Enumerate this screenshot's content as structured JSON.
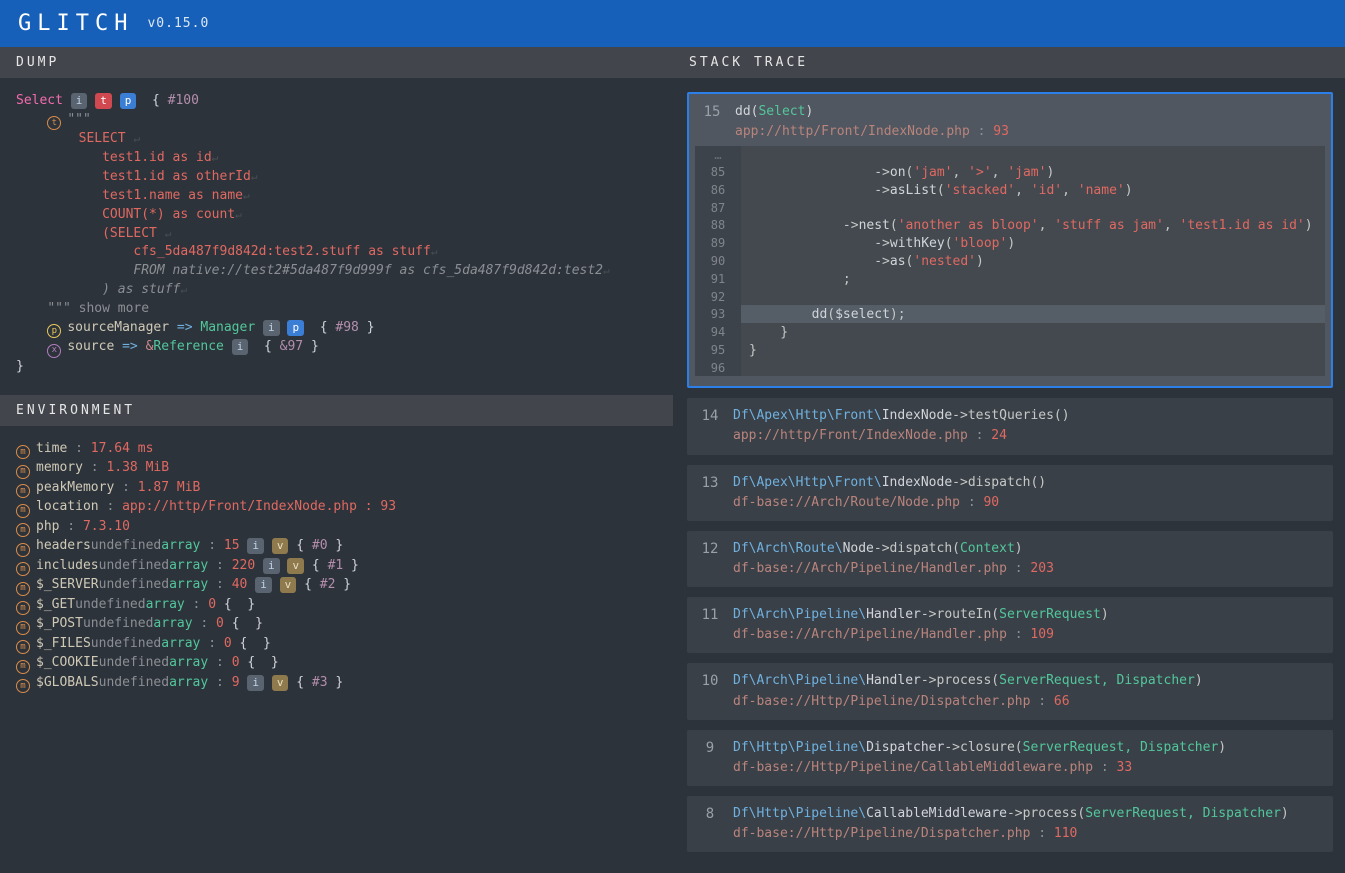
{
  "header": {
    "logo": "GLITCH",
    "version": "v0.15.0"
  },
  "panels": {
    "dump": "DUMP",
    "env": "ENVIRONMENT",
    "stack": "STACK TRACE"
  },
  "dump": {
    "kw_select": "Select",
    "brace_open": " { ",
    "brace_close": " }",
    "hash100": "#100",
    "quotes": "\"\"\"",
    "sql": {
      "select": "SELECT",
      "l1": "test1.id as id",
      "l2": "test1.id as otherId",
      "l3": "test1.name as name",
      "l4": "COUNT(*) as count",
      "l5_open": "(SELECT",
      "l5_col": "cfs_5da487f9d842d:test2.stuff as stuff",
      "l5_from": "FROM native://test2#5da487f9d999f as cfs_5da487f9d842d:test2",
      "l5_close": ") as stuff"
    },
    "show_more": " show more",
    "srcMgr_key": "sourceManager",
    "arrow": " => ",
    "manager": "Manager",
    "hash98": "#98",
    "source_key": "source",
    "amp": "&",
    "reference": "Reference",
    "amp97": "&97"
  },
  "env": [
    {
      "key": "time",
      "val": "17.64 ms",
      "sep": " : ",
      "kind": "val"
    },
    {
      "key": "memory",
      "val": "1.38 MiB",
      "sep": " : ",
      "kind": "val"
    },
    {
      "key": "peakMemory",
      "val": "1.87 MiB",
      "sep": " : ",
      "kind": "val"
    },
    {
      "key": "location",
      "val": "app://http/Front/IndexNode.php : 93",
      "sep": " : ",
      "kind": "val"
    },
    {
      "key": "php",
      "val": "7.3.10",
      "sep": " : ",
      "kind": "val"
    },
    {
      "key": "headers",
      "val": "array : 15",
      "hash": "#0",
      "kind": "arr",
      "badges": "iv"
    },
    {
      "key": "includes",
      "val": "array : 220",
      "hash": "#1",
      "kind": "arr",
      "badges": "iv"
    },
    {
      "key": "$_SERVER",
      "val": "array : 40",
      "hash": "#2",
      "kind": "arr",
      "badges": "iv"
    },
    {
      "key": "$_GET",
      "val": "array : 0",
      "hash": "",
      "kind": "arr0"
    },
    {
      "key": "$_POST",
      "val": "array : 0",
      "hash": "",
      "kind": "arr0"
    },
    {
      "key": "$_FILES",
      "val": "array : 0",
      "hash": "",
      "kind": "arr0"
    },
    {
      "key": "$_COOKIE",
      "val": "array : 0",
      "hash": "",
      "kind": "arr0"
    },
    {
      "key": "$GLOBALS",
      "val": "array : 9",
      "hash": "#3",
      "kind": "arr",
      "badges": "iv"
    }
  ],
  "stack": {
    "active": {
      "no": "15",
      "sig_prefix": "dd(",
      "sig_type": "Select",
      "sig_suffix": ")",
      "loc": "app://http/Front/IndexNode.php",
      "ln": "93",
      "code": [
        {
          "n": "…",
          "t": "",
          "ell": true
        },
        {
          "n": "85",
          "t": "                ->on('jam', '>', 'jam')"
        },
        {
          "n": "86",
          "t": "                ->asList('stacked', 'id', 'name')"
        },
        {
          "n": "87",
          "t": ""
        },
        {
          "n": "88",
          "t": "            ->nest('another as bloop', 'stuff as jam', 'test1.id as id')"
        },
        {
          "n": "89",
          "t": "                ->withKey('bloop')"
        },
        {
          "n": "90",
          "t": "                ->as('nested')"
        },
        {
          "n": "91",
          "t": "            ;"
        },
        {
          "n": "92",
          "t": ""
        },
        {
          "n": "93",
          "t": "        dd($select);",
          "cur": true
        },
        {
          "n": "94",
          "t": "    }"
        },
        {
          "n": "95",
          "t": "}"
        },
        {
          "n": "96",
          "t": ""
        }
      ]
    },
    "frames": [
      {
        "no": "14",
        "ns": "Df\\Apex\\Http\\Front\\",
        "cls": "IndexNode",
        "mth": "->testQueries()",
        "loc": "app://http/Front/IndexNode.php",
        "ln": "24"
      },
      {
        "no": "13",
        "ns": "Df\\Apex\\Http\\Front\\",
        "cls": "IndexNode",
        "mth": "->dispatch()",
        "loc": "df-base://Arch/Route/Node.php",
        "ln": "90"
      },
      {
        "no": "12",
        "ns": "Df\\Arch\\Route\\",
        "cls": "Node",
        "mth": "->dispatch(",
        "args": "Context",
        "mth2": ")",
        "loc": "df-base://Arch/Pipeline/Handler.php",
        "ln": "203"
      },
      {
        "no": "11",
        "ns": "Df\\Arch\\Pipeline\\",
        "cls": "Handler",
        "mth": "->routeIn(",
        "args": "ServerRequest",
        "mth2": ")",
        "loc": "df-base://Arch/Pipeline/Handler.php",
        "ln": "109"
      },
      {
        "no": "10",
        "ns": "Df\\Arch\\Pipeline\\",
        "cls": "Handler",
        "mth": "->process(",
        "args": "ServerRequest, Dispatcher",
        "mth2": ")",
        "loc": "df-base://Http/Pipeline/Dispatcher.php",
        "ln": "66"
      },
      {
        "no": "9",
        "ns": "Df\\Http\\Pipeline\\",
        "cls": "Dispatcher",
        "mth": "->closure(",
        "args": "ServerRequest, Dispatcher",
        "mth2": ")",
        "loc": "df-base://Http/Pipeline/CallableMiddleware.php",
        "ln": "33"
      },
      {
        "no": "8",
        "ns": "Df\\Http\\Pipeline\\",
        "cls": "CallableMiddleware",
        "mth": "->process(",
        "args": "ServerRequest, Dispatcher",
        "mth2": ")",
        "loc": "df-base://Http/Pipeline/Dispatcher.php",
        "ln": "110"
      }
    ]
  },
  "badges": {
    "i": "i",
    "t": "t",
    "p": "p",
    "v": "v"
  }
}
